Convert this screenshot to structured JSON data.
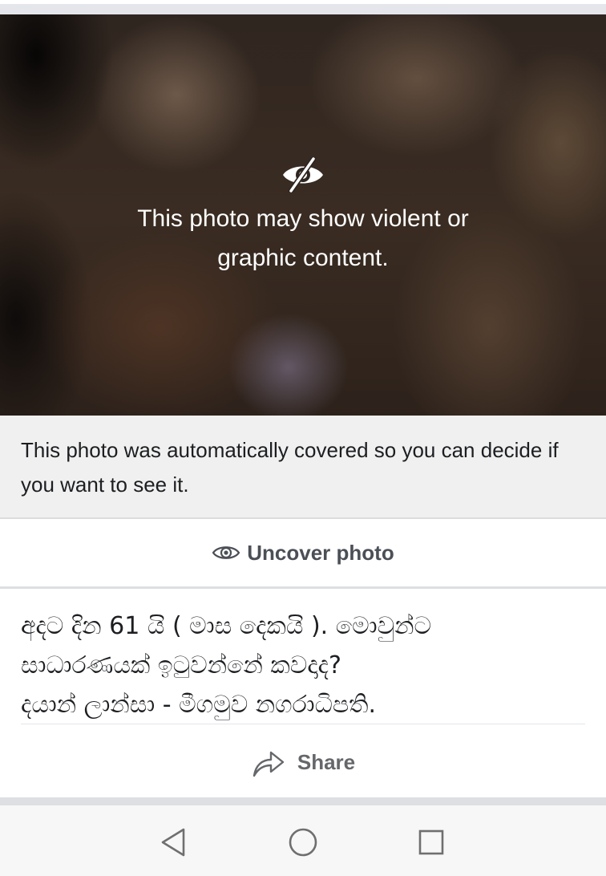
{
  "cover": {
    "warning_text": "This photo may show violent or graphic content.",
    "icon": "eye-slash-icon"
  },
  "notice": {
    "text": "This photo was automatically covered so you can decide if you want to see it."
  },
  "uncover": {
    "label": "Uncover photo",
    "icon": "eye-icon"
  },
  "post": {
    "lines": [
      "අදට දින 61 යි ( මාස දෙකයි ). මොවුන්ට",
      "සාධාරණයක් ඉටුවන්නේ කවදාද?",
      "දයාන් ලාන්සා - මීගමුව නගරාධිපති."
    ]
  },
  "share": {
    "label": "Share",
    "icon": "share-arrow-icon"
  },
  "navigation": {
    "back_icon": "back-triangle-icon",
    "home_icon": "home-circle-icon",
    "recents_icon": "recents-square-icon"
  },
  "colors": {
    "notice_bg": "#f0f0f0",
    "button_text": "#4b4f56",
    "share_text": "#65676b",
    "nav_bg": "#f7f7f7"
  }
}
